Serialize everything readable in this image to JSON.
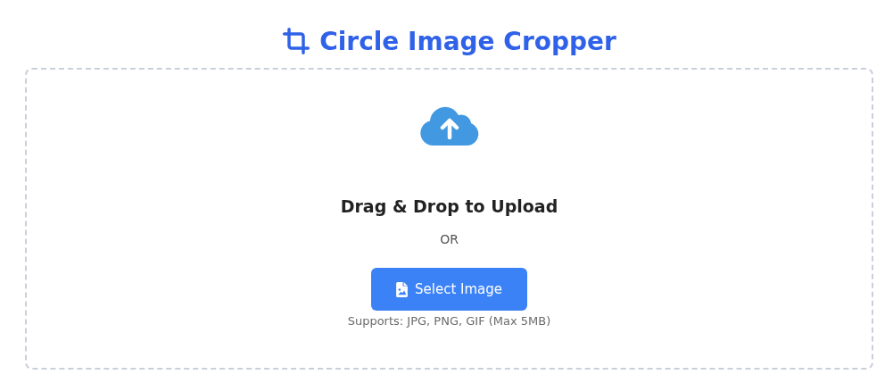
{
  "header": {
    "title": "Circle Image Cropper"
  },
  "upload": {
    "heading": "Drag & Drop to Upload",
    "separator": "OR",
    "button": "Select Image",
    "note": "Supports: JPG, PNG, GIF (Max 5MB)"
  }
}
